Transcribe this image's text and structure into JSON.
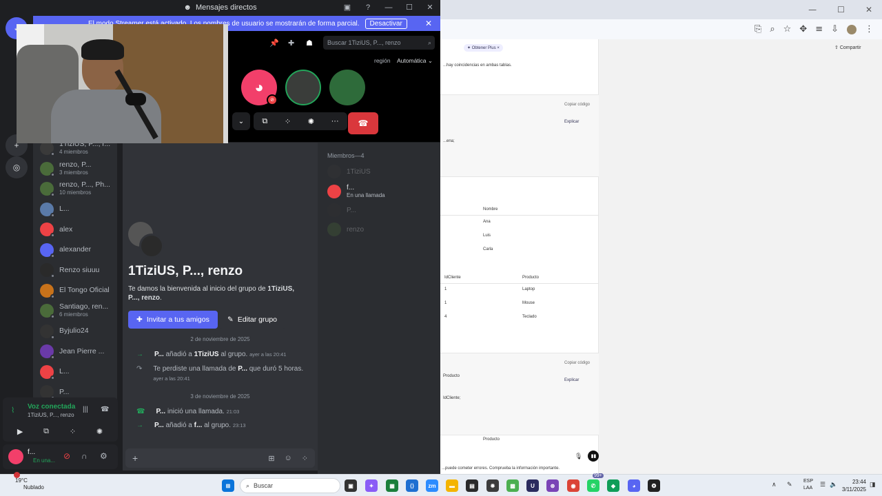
{
  "discord": {
    "window_title": "Mensajes directos",
    "streamer_banner": {
      "text": "El modo Streamer está activado. Los nombres de usuario se mostrarán de forma parcial.",
      "button": "Desactivar"
    },
    "search_placeholder": "Buscar 1TiziUS, P..., renzo",
    "region_label": "región",
    "region_value": "Automática",
    "dm_list": [
      {
        "name": "1TiziUS, P..., r...",
        "sub": "4 miembros",
        "color": "#3a3a3a"
      },
      {
        "name": "renzo, P...",
        "sub": "3 miembros",
        "color": "#4a6b3a"
      },
      {
        "name": "renzo, P..., Ph...",
        "sub": "10 miembros",
        "color": "#4a6b3a"
      },
      {
        "name": "L...",
        "sub": "",
        "color": "#5a7aa8"
      },
      {
        "name": "alex",
        "sub": "",
        "color": "#ed4245"
      },
      {
        "name": "alexander",
        "sub": "",
        "color": "#5865f2"
      },
      {
        "name": "Renzo siuuu",
        "sub": "",
        "color": "#2a2a2a"
      },
      {
        "name": "El Tongo Oficial",
        "sub": "",
        "color": "#c8721a"
      },
      {
        "name": "Santiago, ren...",
        "sub": "6 miembros",
        "color": "#4a6b3a"
      },
      {
        "name": "Byjulio24",
        "sub": "",
        "color": "#333"
      },
      {
        "name": "Jean Pierre ...",
        "sub": "",
        "color": "#6a3aa8"
      },
      {
        "name": "L...",
        "sub": "",
        "color": "#ed4245"
      },
      {
        "name": "P...",
        "sub": "",
        "color": "#333"
      }
    ],
    "voice": {
      "status": "Voz conectada",
      "channel": "1TiziUS, P..., renzo"
    },
    "user": {
      "name": "f...",
      "status": "En una..."
    },
    "group": {
      "title": "1TiziUS, P..., renzo",
      "welcome_prefix": "Te damos la bienvenida al inicio del grupo de ",
      "welcome_bold": "1TiziUS, P..., renzo",
      "welcome_suffix": ".",
      "invite_button": "Invitar a tus amigos",
      "edit_button": "Editar grupo"
    },
    "messages": [
      {
        "type": "date",
        "text": "2 de noviembre de 2025"
      },
      {
        "type": "join",
        "user": "P...",
        "action": "añadió a",
        "target": "1TiziUS",
        "rest": "al grupo.",
        "time": "ayer a las 20:41"
      },
      {
        "type": "missed",
        "pre": "Te perdiste una llamada de",
        "user": "P...",
        "rest": "que duró 5 horas.",
        "time": "ayer a las 20:41"
      },
      {
        "type": "date",
        "text": "3 de noviembre de 2025"
      },
      {
        "type": "call",
        "user": "P...",
        "rest": "inició una llamada.",
        "time": "21:03"
      },
      {
        "type": "join",
        "user": "P...",
        "action": "añadió a",
        "target": "f...",
        "rest": "al grupo.",
        "time": "23:13"
      }
    ],
    "members_header": "Miembros—4",
    "members": [
      {
        "name": "1TiziUS",
        "sub": "",
        "color": "#3a3a3a",
        "dim": true
      },
      {
        "name": "f...",
        "sub": "En una llamada",
        "color": "#ed4245",
        "dim": false
      },
      {
        "name": "P...",
        "sub": "",
        "color": "#333",
        "dim": true
      },
      {
        "name": "renzo",
        "sub": "",
        "color": "#4a6b3a",
        "dim": true
      }
    ]
  },
  "browser": {
    "plus_pill": "Obtener Plus",
    "share": "Compartir",
    "chat_lines": [
      "...hay coincidencias en ambas tablas.",
      "Copiar código",
      "Explicar",
      "...ena;",
      "Nombre",
      "Ana",
      "Luis",
      "Carla",
      "IdCliente",
      "Producto",
      "1",
      "Laptop",
      "1",
      "Mouse",
      "4",
      "Teclado",
      "Copiar código",
      "Producto",
      "Explicar",
      "IdCliente;",
      "Producto",
      "...puede cometer errores. Comprueba la información importante."
    ]
  },
  "taskbar": {
    "weather_temp": "19°C",
    "weather_desc": "Nublado",
    "search": "Buscar",
    "lang": "ESP",
    "lang_sub": "LAA",
    "time": "23:44",
    "date": "3/11/2025",
    "badge": "99+"
  }
}
